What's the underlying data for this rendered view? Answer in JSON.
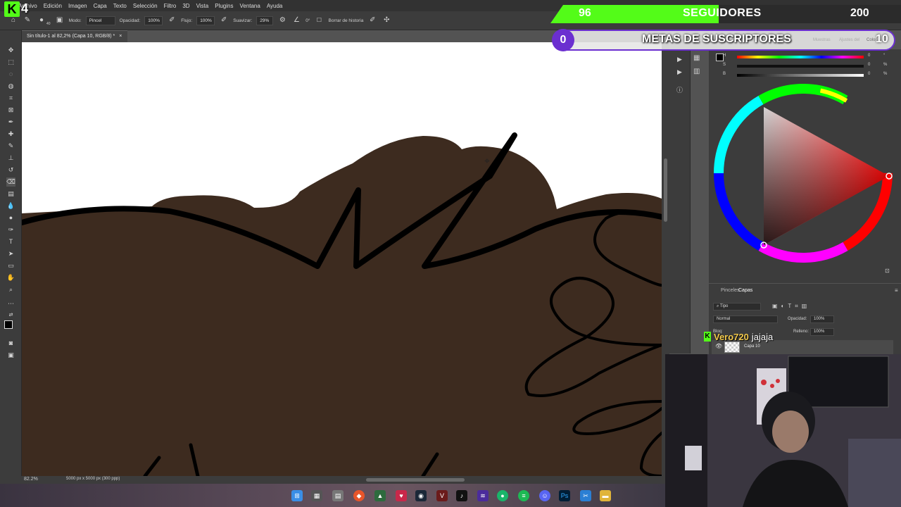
{
  "menu": [
    "Archivo",
    "Edición",
    "Imagen",
    "Capa",
    "Texto",
    "Selección",
    "Filtro",
    "3D",
    "Vista",
    "Plugins",
    "Ventana",
    "Ayuda"
  ],
  "options": {
    "brush_size": "40",
    "mode_label": "Modo:",
    "mode_value": "Pincel",
    "opacity_label": "Opacidad:",
    "opacity_value": "100%",
    "flow_label": "Flujo:",
    "flow_value": "100%",
    "smooth_label": "Suavizar:",
    "smooth_value": "29%",
    "angle_value": "0°",
    "history_label": "Borrar de historia"
  },
  "document": {
    "tab_title": "Sin título-1 al 82,2% (Capa 10, RGB/8) *",
    "zoom": "82.2%",
    "dimensions": "5000 px x 5000 px (300 ppp)",
    "canvas_color": "#3d2b1f"
  },
  "color_panel": {
    "tabs": [
      "Muestras",
      "Ajustes del",
      "Color"
    ],
    "sliders": [
      {
        "label": "H",
        "value": "0",
        "unit": "°"
      },
      {
        "label": "S",
        "value": "0",
        "unit": "%"
      },
      {
        "label": "B",
        "value": "0",
        "unit": "%"
      }
    ]
  },
  "layers_panel": {
    "tabs": [
      "Pinceles",
      "Capas"
    ],
    "filter": "Tipo",
    "blend_mode": "Normal",
    "opacity_label": "Opacidad:",
    "opacity_value": "100%",
    "lock_label": "Bloq:",
    "fill_label": "Relleno:",
    "fill_value": "100%",
    "layer_name": "Capa 10"
  },
  "overlay": {
    "kick_logo": "K",
    "kick_count": "4",
    "followers_current": "96",
    "followers_title": "SEGUIDORES",
    "followers_goal": "200",
    "followers_progress": 0.48,
    "subs_current": "0",
    "subs_title": "METAS DE SUSCRIPTORES",
    "subs_goal": "10",
    "chat_badge": "K",
    "chat_user": "Vero720",
    "chat_text": "jajaja"
  },
  "colors": {
    "accent_green": "#53fc18",
    "accent_purple": "#6b2fd0",
    "ps_panel": "#3c3c3c"
  }
}
